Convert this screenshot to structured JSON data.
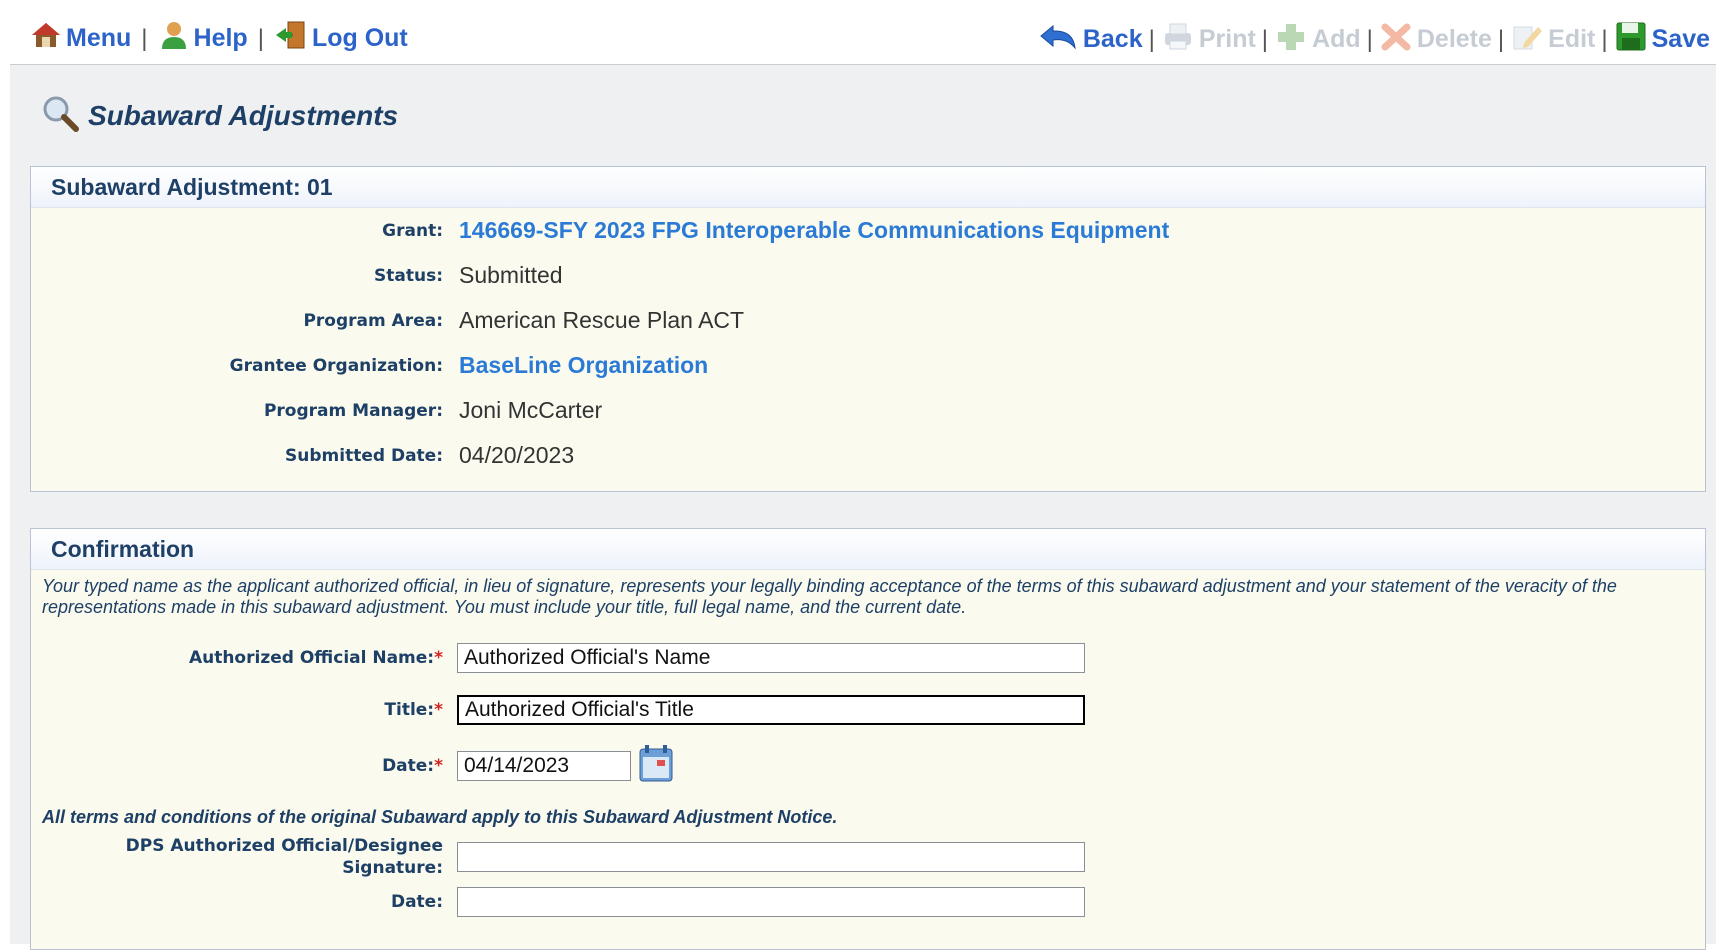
{
  "toolbar": {
    "left": [
      {
        "label": "Menu",
        "icon": "home-icon"
      },
      {
        "label": "Help",
        "icon": "user-help-icon"
      },
      {
        "label": "Log Out",
        "icon": "logout-door-icon"
      }
    ],
    "right": [
      {
        "label": "Back",
        "icon": "back-arrow-icon",
        "enabled": true
      },
      {
        "label": "Print",
        "icon": "print-icon",
        "enabled": false
      },
      {
        "label": "Add",
        "icon": "add-plus-icon",
        "enabled": false
      },
      {
        "label": "Delete",
        "icon": "delete-x-icon",
        "enabled": false
      },
      {
        "label": "Edit",
        "icon": "edit-pencil-icon",
        "enabled": false
      },
      {
        "label": "Save",
        "icon": "save-disk-icon",
        "enabled": true
      }
    ],
    "separator": "|"
  },
  "page": {
    "title": "Subaward Adjustments",
    "title_icon": "magnifier-icon"
  },
  "summary": {
    "heading": "Subaward Adjustment: 01",
    "fields": [
      {
        "label": "Grant:",
        "value": "146669-SFY 2023 FPG Interoperable Communications Equipment",
        "link": true
      },
      {
        "label": "Status:",
        "value": "Submitted",
        "link": false
      },
      {
        "label": "Program Area:",
        "value": "American Rescue Plan ACT",
        "link": false
      },
      {
        "label": "Grantee Organization:",
        "value": "BaseLine Organization",
        "link": true
      },
      {
        "label": "Program Manager:",
        "value": "Joni McCarter",
        "link": false
      },
      {
        "label": "Submitted Date:",
        "value": "04/20/2023",
        "link": false
      }
    ]
  },
  "confirmation": {
    "heading": "Confirmation",
    "notice": "Your typed name as the applicant authorized official, in lieu of signature, represents your legally binding acceptance of the terms of this subaward adjustment and your statement of the veracity of the representations made in this subaward adjustment. You must include your title, full legal name, and the current date.",
    "required_mark": "*",
    "official_name": {
      "label": "Authorized Official Name:",
      "value": "Authorized Official's Name"
    },
    "title": {
      "label": "Title:",
      "value": "Authorized Official's Title"
    },
    "date": {
      "label": "Date:",
      "value": "04/14/2023"
    },
    "terms_note": "All terms and conditions of the original Subaward apply to this Subaward Adjustment Notice.",
    "dps_signature": {
      "label_line1": "DPS Authorized Official/Designee",
      "label_line2": "Signature:",
      "value": ""
    },
    "dps_date": {
      "label": "Date:",
      "value": ""
    }
  },
  "colors": {
    "link": "#2b7bd6",
    "toolbar_link": "#2b63c9",
    "label": "#1e3f66",
    "panel_bg": "#fafbee",
    "page_bg": "#eef0f2",
    "required": "#d32020",
    "disabled": "#c6ccd4"
  }
}
